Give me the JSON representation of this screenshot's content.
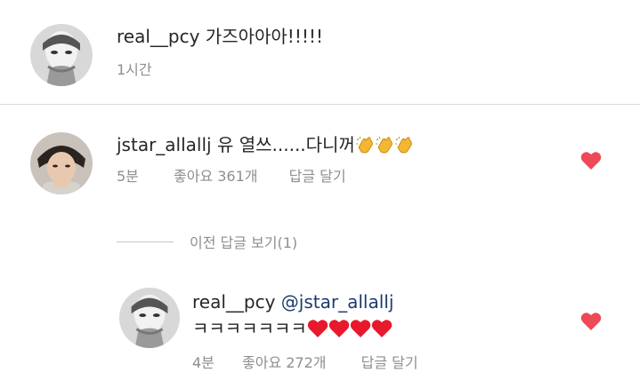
{
  "comments": [
    {
      "username": "real__pcy",
      "text": "가즈아아아!!!!!",
      "time": "1시간"
    },
    {
      "username": "jstar_allallj",
      "text": "유 열쓰......다니꺼",
      "emoji_count": 3,
      "emoji": "clapping-hands",
      "time": "5분",
      "likes": "좋아요 361개",
      "reply": "답글 달기"
    }
  ],
  "view_previous": "이전 답글 보기(1)",
  "reply_comment": {
    "username": "real__pcy",
    "mention": "@jstar_allallj",
    "text": "ㅋㅋㅋㅋㅋㅋㅋ",
    "emoji_count": 4,
    "emoji": "red-heart",
    "time": "4분",
    "likes": "좋아요 272개",
    "reply": "답글 달기"
  },
  "colors": {
    "like_heart": "#ed4956",
    "muted_text": "#8e8e8e",
    "mention": "#1e3a6e"
  }
}
